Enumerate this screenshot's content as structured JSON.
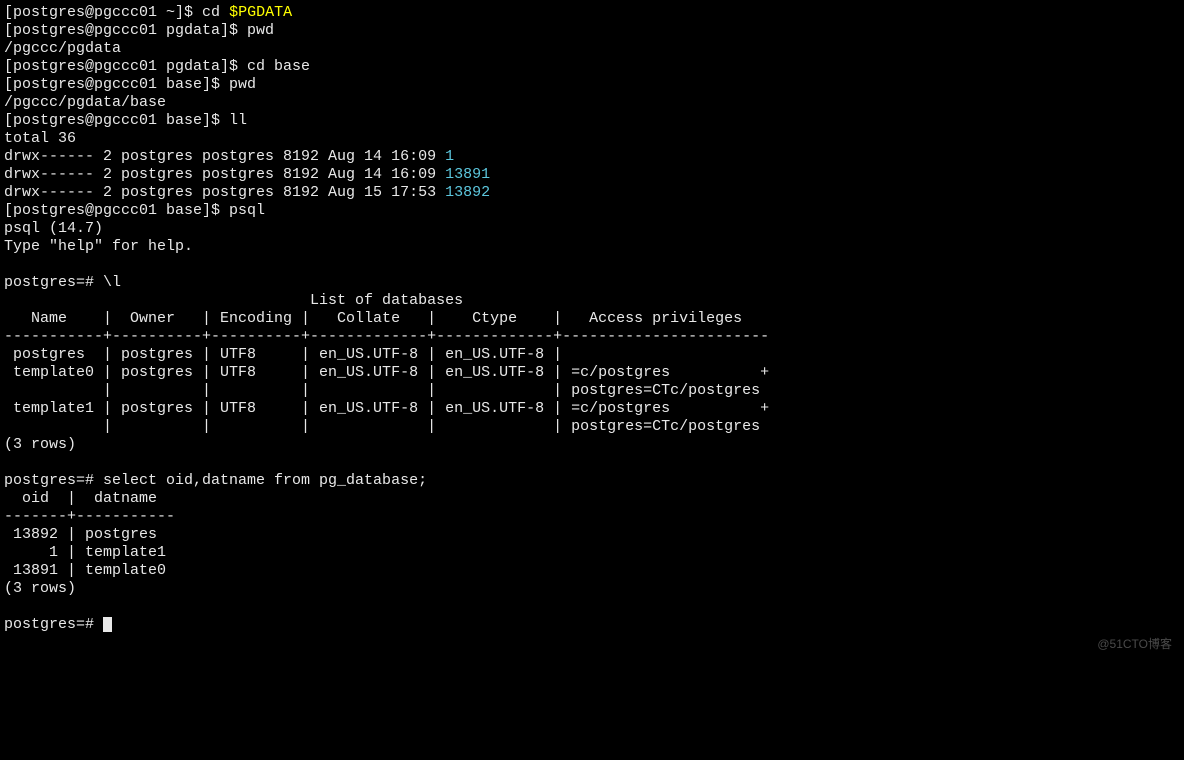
{
  "watermark": "@51CTO博客",
  "lines": {
    "0": {
      "prompt": "[postgres@pgccc01 ~]$ ",
      "cmd": "cd ",
      "arg": "$PGDATA"
    },
    "1": {
      "prompt": "[postgres@pgccc01 pgdata]$ ",
      "cmd": "pwd"
    },
    "2": {
      "text": "/pgccc/pgdata"
    },
    "3": {
      "prompt": "[postgres@pgccc01 pgdata]$ ",
      "cmd": "cd base"
    },
    "4": {
      "prompt": "[postgres@pgccc01 base]$ ",
      "cmd": "pwd"
    },
    "5": {
      "text": "/pgccc/pgdata/base"
    },
    "6": {
      "prompt": "[postgres@pgccc01 base]$ ",
      "cmd": "ll"
    },
    "7": {
      "text": "total 36"
    },
    "8": {
      "text": "drwx------ 2 postgres postgres 8192 Aug 14 16:09 ",
      "dir": "1"
    },
    "9": {
      "text": "drwx------ 2 postgres postgres 8192 Aug 14 16:09 ",
      "dir": "13891"
    },
    "10": {
      "text": "drwx------ 2 postgres postgres 8192 Aug 15 17:53 ",
      "dir": "13892"
    },
    "11": {
      "prompt": "[postgres@pgccc01 base]$ ",
      "cmd": "psql"
    },
    "12": {
      "text": "psql (14.7)"
    },
    "13": {
      "text": "Type \"help\" for help."
    },
    "15": {
      "text": "postgres=# \\l"
    },
    "16": {
      "text": "                                  List of databases"
    },
    "17": {
      "text": "   Name    |  Owner   | Encoding |   Collate   |    Ctype    |   Access privileges   "
    },
    "18": {
      "text": "-----------+----------+----------+-------------+-------------+-----------------------"
    },
    "19": {
      "text": " postgres  | postgres | UTF8     | en_US.UTF-8 | en_US.UTF-8 | "
    },
    "20": {
      "text": " template0 | postgres | UTF8     | en_US.UTF-8 | en_US.UTF-8 | =c/postgres          +"
    },
    "21": {
      "text": "           |          |          |             |             | postgres=CTc/postgres"
    },
    "22": {
      "text": " template1 | postgres | UTF8     | en_US.UTF-8 | en_US.UTF-8 | =c/postgres          +"
    },
    "23": {
      "text": "           |          |          |             |             | postgres=CTc/postgres"
    },
    "24": {
      "text": "(3 rows)"
    },
    "26": {
      "text": "postgres=# select oid,datname from pg_database;"
    },
    "27": {
      "text": "  oid  |  datname  "
    },
    "28": {
      "text": "-------+-----------"
    },
    "29": {
      "text": " 13892 | postgres"
    },
    "30": {
      "text": "     1 | template1"
    },
    "31": {
      "text": " 13891 | template0"
    },
    "32": {
      "text": "(3 rows)"
    },
    "34": {
      "text": "postgres=# "
    }
  }
}
